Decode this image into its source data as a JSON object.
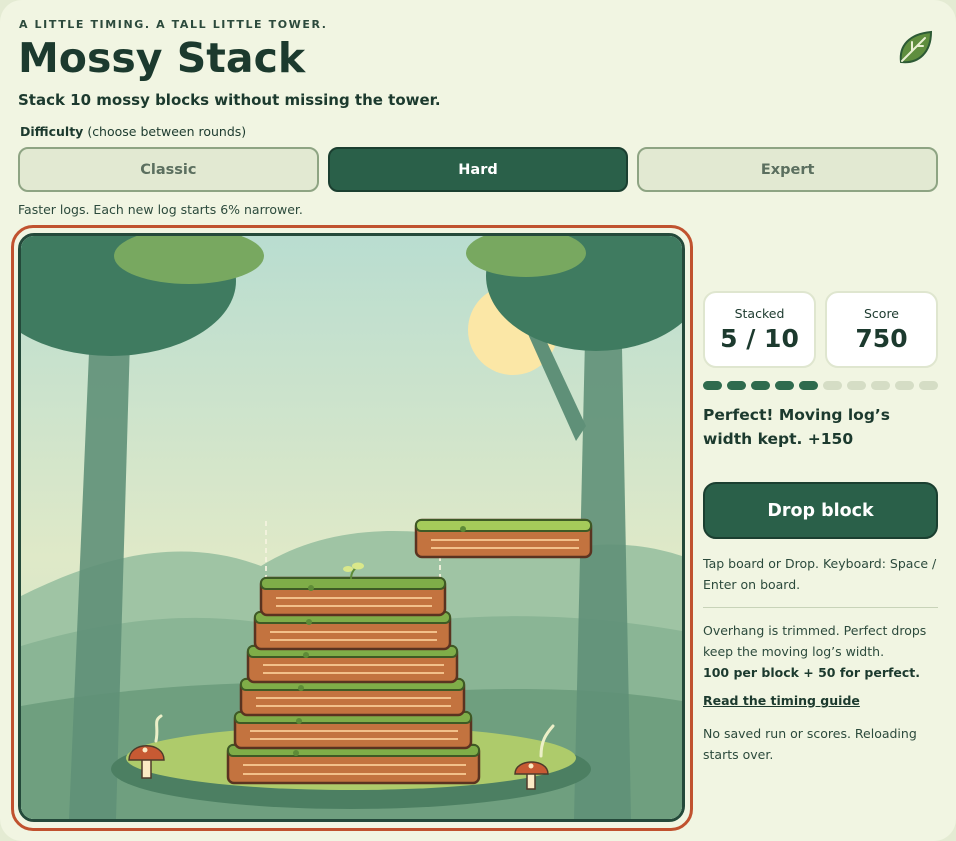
{
  "header": {
    "eyebrow": "A LITTLE TIMING. A TALL LITTLE TOWER.",
    "title": "Mossy Stack",
    "subtitle": "Stack 10 mossy blocks without missing the tower.",
    "icon": "leaf-icon"
  },
  "difficulty": {
    "label": "Difficulty",
    "label_note": "(choose between rounds)",
    "options": [
      {
        "label": "Classic",
        "active": false
      },
      {
        "label": "Hard",
        "active": true
      },
      {
        "label": "Expert",
        "active": false
      }
    ],
    "note": "Faster logs. Each new log starts 6% narrower."
  },
  "game": {
    "stacked_placed": 5,
    "stacked_total": 10,
    "moving_log": "mossy log"
  },
  "stats": {
    "stacked_label": "Stacked",
    "stacked_value": "5 / 10",
    "score_label": "Score",
    "score_value": "750"
  },
  "progress": {
    "filled": 5,
    "total": 10
  },
  "feedback": "Perfect! Moving log’s width kept. +150",
  "drop_button": "Drop block",
  "hint": "Tap board or Drop. Keyboard: Space / Enter on board.",
  "rules": {
    "line1": "Overhang is trimmed. Perfect drops keep the moving log’s width.",
    "line2": "100 per block + 50 for perfect."
  },
  "guide_link": "Read the timing guide",
  "saved_note": "No saved run or scores. Reloading starts over.",
  "colors": {
    "accent": "#2a6049",
    "board_border": "#c0522f",
    "log_wood": "#c3733f",
    "moss": "#7fad48"
  }
}
